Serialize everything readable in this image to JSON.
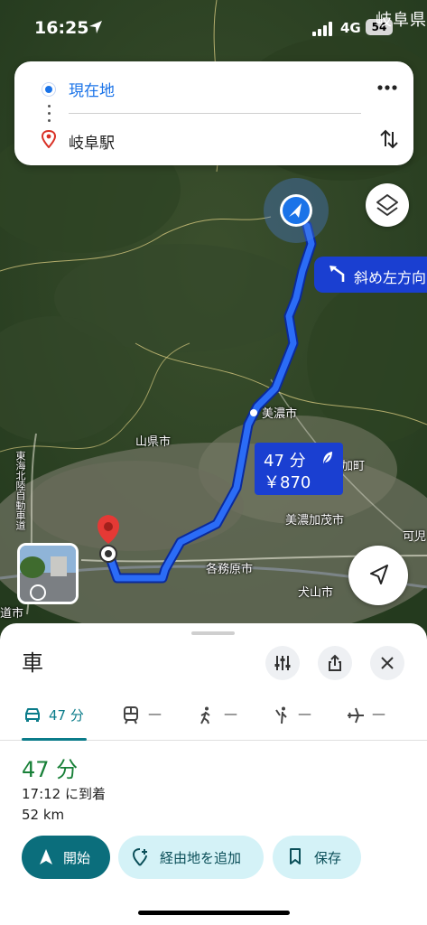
{
  "status_bar": {
    "time": "16:25",
    "network": "4G",
    "battery": "54",
    "place_name": "岐阜県"
  },
  "route_card": {
    "origin": "現在地",
    "destination": "岐阜駅"
  },
  "map": {
    "turn_instruction": "斜め左方向",
    "route_time": "47 分",
    "route_cost": "￥870",
    "labels": {
      "mino": "美濃市",
      "yamagata": "山県市",
      "kakamigahara": "各務原市",
      "minokamo": "美濃加茂市",
      "inuyama": "犬山市",
      "kani": "可児",
      "tomika": "加町",
      "expressway": "東海北陸自動車道",
      "left_edge": "道市"
    }
  },
  "sheet": {
    "mode_title": "車",
    "tabs": [
      {
        "label": "47 分",
        "icon": "car-icon"
      },
      {
        "label": "—",
        "icon": "transit-icon"
      },
      {
        "label": "—",
        "icon": "walk-icon"
      },
      {
        "label": "—",
        "icon": "rideshare-icon"
      },
      {
        "label": "—",
        "icon": "flight-icon"
      }
    ],
    "eta": "47 分",
    "arrival": "17:12 に到着",
    "distance": "52 km",
    "actions": {
      "start": "開始",
      "add_waypoint": "経由地を追加",
      "save": "保存"
    }
  },
  "colors": {
    "accent": "#0b6e7c",
    "route_blue": "#1a3fd1",
    "eta_green": "#188038",
    "origin_blue": "#1a73e8"
  }
}
